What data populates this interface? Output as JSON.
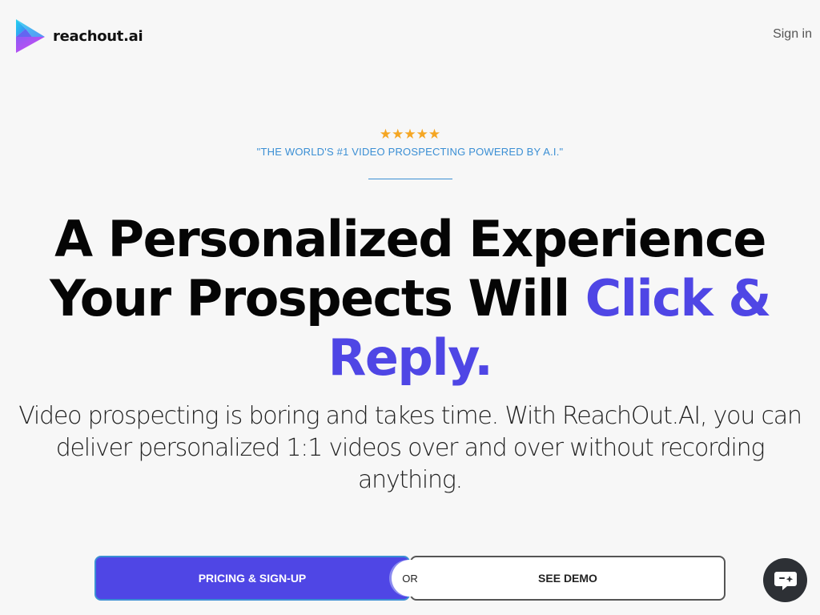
{
  "header": {
    "brand_name": "reachout.ai",
    "signin_label": "Sign in"
  },
  "hero": {
    "rating_stars": "★★★★★",
    "tagline": "\"THE WORLD'S #1 VIDEO PROSPECTING POWERED BY A.I.\"",
    "headline_line1": "A Personalized Experience",
    "headline_line2_plain": "Your Prospects Will ",
    "headline_line2_accent": "Click &",
    "headline_line3_accent": "Reply.",
    "subtext": "Video prospecting is boring and takes time. With ReachOut.AI, you can deliver personalized 1:1 videos over and over without recording anything."
  },
  "cta": {
    "primary_label": "PRICING & SIGN-UP",
    "or_label": "OR",
    "secondary_label": "SEE DEMO"
  },
  "icons": {
    "logo": "play-triangle-logo-icon",
    "chat": "chat-sparkle-icon"
  },
  "colors": {
    "accent": "#4f46e5",
    "tagline": "#3b8fd4",
    "stars": "#f5a623",
    "chat_bg": "#2d3035"
  }
}
